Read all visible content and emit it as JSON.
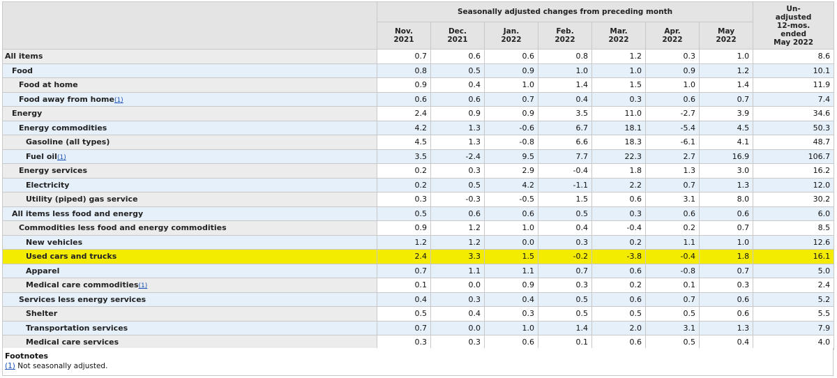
{
  "header": {
    "group_title": "Seasonally adjusted changes from preceding month",
    "unadjusted_title": "Un-\nadjusted\n12-mos.\nended\nMay 2022",
    "months": [
      "Nov.\n2021",
      "Dec.\n2021",
      "Jan.\n2022",
      "Feb.\n2022",
      "Mar.\n2022",
      "Apr.\n2022",
      "May\n2022"
    ]
  },
  "rows": [
    {
      "label": "All items",
      "level": 1,
      "footnote": "",
      "values": [
        "0.7",
        "0.6",
        "0.6",
        "0.8",
        "1.2",
        "0.3",
        "1.0",
        "8.6"
      ]
    },
    {
      "label": "Food",
      "level": 2,
      "footnote": "",
      "values": [
        "0.8",
        "0.5",
        "0.9",
        "1.0",
        "1.0",
        "0.9",
        "1.2",
        "10.1"
      ]
    },
    {
      "label": "Food at home",
      "level": 3,
      "footnote": "",
      "values": [
        "0.9",
        "0.4",
        "1.0",
        "1.4",
        "1.5",
        "1.0",
        "1.4",
        "11.9"
      ]
    },
    {
      "label": "Food away from home",
      "level": 3,
      "footnote": "(1)",
      "values": [
        "0.6",
        "0.6",
        "0.7",
        "0.4",
        "0.3",
        "0.6",
        "0.7",
        "7.4"
      ]
    },
    {
      "label": "Energy",
      "level": 2,
      "footnote": "",
      "values": [
        "2.4",
        "0.9",
        "0.9",
        "3.5",
        "11.0",
        "-2.7",
        "3.9",
        "34.6"
      ]
    },
    {
      "label": "Energy commodities",
      "level": 3,
      "footnote": "",
      "values": [
        "4.2",
        "1.3",
        "-0.6",
        "6.7",
        "18.1",
        "-5.4",
        "4.5",
        "50.3"
      ]
    },
    {
      "label": "Gasoline (all types)",
      "level": 4,
      "footnote": "",
      "values": [
        "4.5",
        "1.3",
        "-0.8",
        "6.6",
        "18.3",
        "-6.1",
        "4.1",
        "48.7"
      ]
    },
    {
      "label": "Fuel oil",
      "level": 4,
      "footnote": "(1)",
      "values": [
        "3.5",
        "-2.4",
        "9.5",
        "7.7",
        "22.3",
        "2.7",
        "16.9",
        "106.7"
      ]
    },
    {
      "label": "Energy services",
      "level": 3,
      "footnote": "",
      "values": [
        "0.2",
        "0.3",
        "2.9",
        "-0.4",
        "1.8",
        "1.3",
        "3.0",
        "16.2"
      ]
    },
    {
      "label": "Electricity",
      "level": 4,
      "footnote": "",
      "values": [
        "0.2",
        "0.5",
        "4.2",
        "-1.1",
        "2.2",
        "0.7",
        "1.3",
        "12.0"
      ]
    },
    {
      "label": "Utility (piped) gas service",
      "level": 4,
      "footnote": "",
      "values": [
        "0.3",
        "-0.3",
        "-0.5",
        "1.5",
        "0.6",
        "3.1",
        "8.0",
        "30.2"
      ]
    },
    {
      "label": "All items less food and energy",
      "level": 2,
      "footnote": "",
      "values": [
        "0.5",
        "0.6",
        "0.6",
        "0.5",
        "0.3",
        "0.6",
        "0.6",
        "6.0"
      ]
    },
    {
      "label": "Commodities less food and energy commodities",
      "level": 3,
      "footnote": "",
      "values": [
        "0.9",
        "1.2",
        "1.0",
        "0.4",
        "-0.4",
        "0.2",
        "0.7",
        "8.5"
      ]
    },
    {
      "label": "New vehicles",
      "level": 4,
      "footnote": "",
      "values": [
        "1.2",
        "1.2",
        "0.0",
        "0.3",
        "0.2",
        "1.1",
        "1.0",
        "12.6"
      ]
    },
    {
      "label": "Used cars and trucks",
      "level": 4,
      "footnote": "",
      "highlight": true,
      "values": [
        "2.4",
        "3.3",
        "1.5",
        "-0.2",
        "-3.8",
        "-0.4",
        "1.8",
        "16.1"
      ]
    },
    {
      "label": "Apparel",
      "level": 4,
      "footnote": "",
      "values": [
        "0.7",
        "1.1",
        "1.1",
        "0.7",
        "0.6",
        "-0.8",
        "0.7",
        "5.0"
      ]
    },
    {
      "label": "Medical care commodities",
      "level": 4,
      "footnote": "(1)",
      "values": [
        "0.1",
        "0.0",
        "0.9",
        "0.3",
        "0.2",
        "0.1",
        "0.3",
        "2.4"
      ]
    },
    {
      "label": "Services less energy services",
      "level": 3,
      "footnote": "",
      "values": [
        "0.4",
        "0.3",
        "0.4",
        "0.5",
        "0.6",
        "0.7",
        "0.6",
        "5.2"
      ]
    },
    {
      "label": "Shelter",
      "level": 4,
      "footnote": "",
      "values": [
        "0.5",
        "0.4",
        "0.3",
        "0.5",
        "0.5",
        "0.5",
        "0.6",
        "5.5"
      ]
    },
    {
      "label": "Transportation services",
      "level": 4,
      "footnote": "",
      "values": [
        "0.7",
        "0.0",
        "1.0",
        "1.4",
        "2.0",
        "3.1",
        "1.3",
        "7.9"
      ]
    },
    {
      "label": "Medical care services",
      "level": 4,
      "footnote": "",
      "values": [
        "0.3",
        "0.3",
        "0.6",
        "0.1",
        "0.6",
        "0.5",
        "0.4",
        "4.0"
      ]
    }
  ],
  "footnotes": {
    "heading": "Footnotes",
    "marker": "(1)",
    "text": " Not seasonally adjusted."
  },
  "colors": {
    "header_bg": "#e4e4e4",
    "label_alt_bg": "#e6f0fb",
    "highlight": "#f4ec00",
    "link": "#1a4fb8"
  }
}
